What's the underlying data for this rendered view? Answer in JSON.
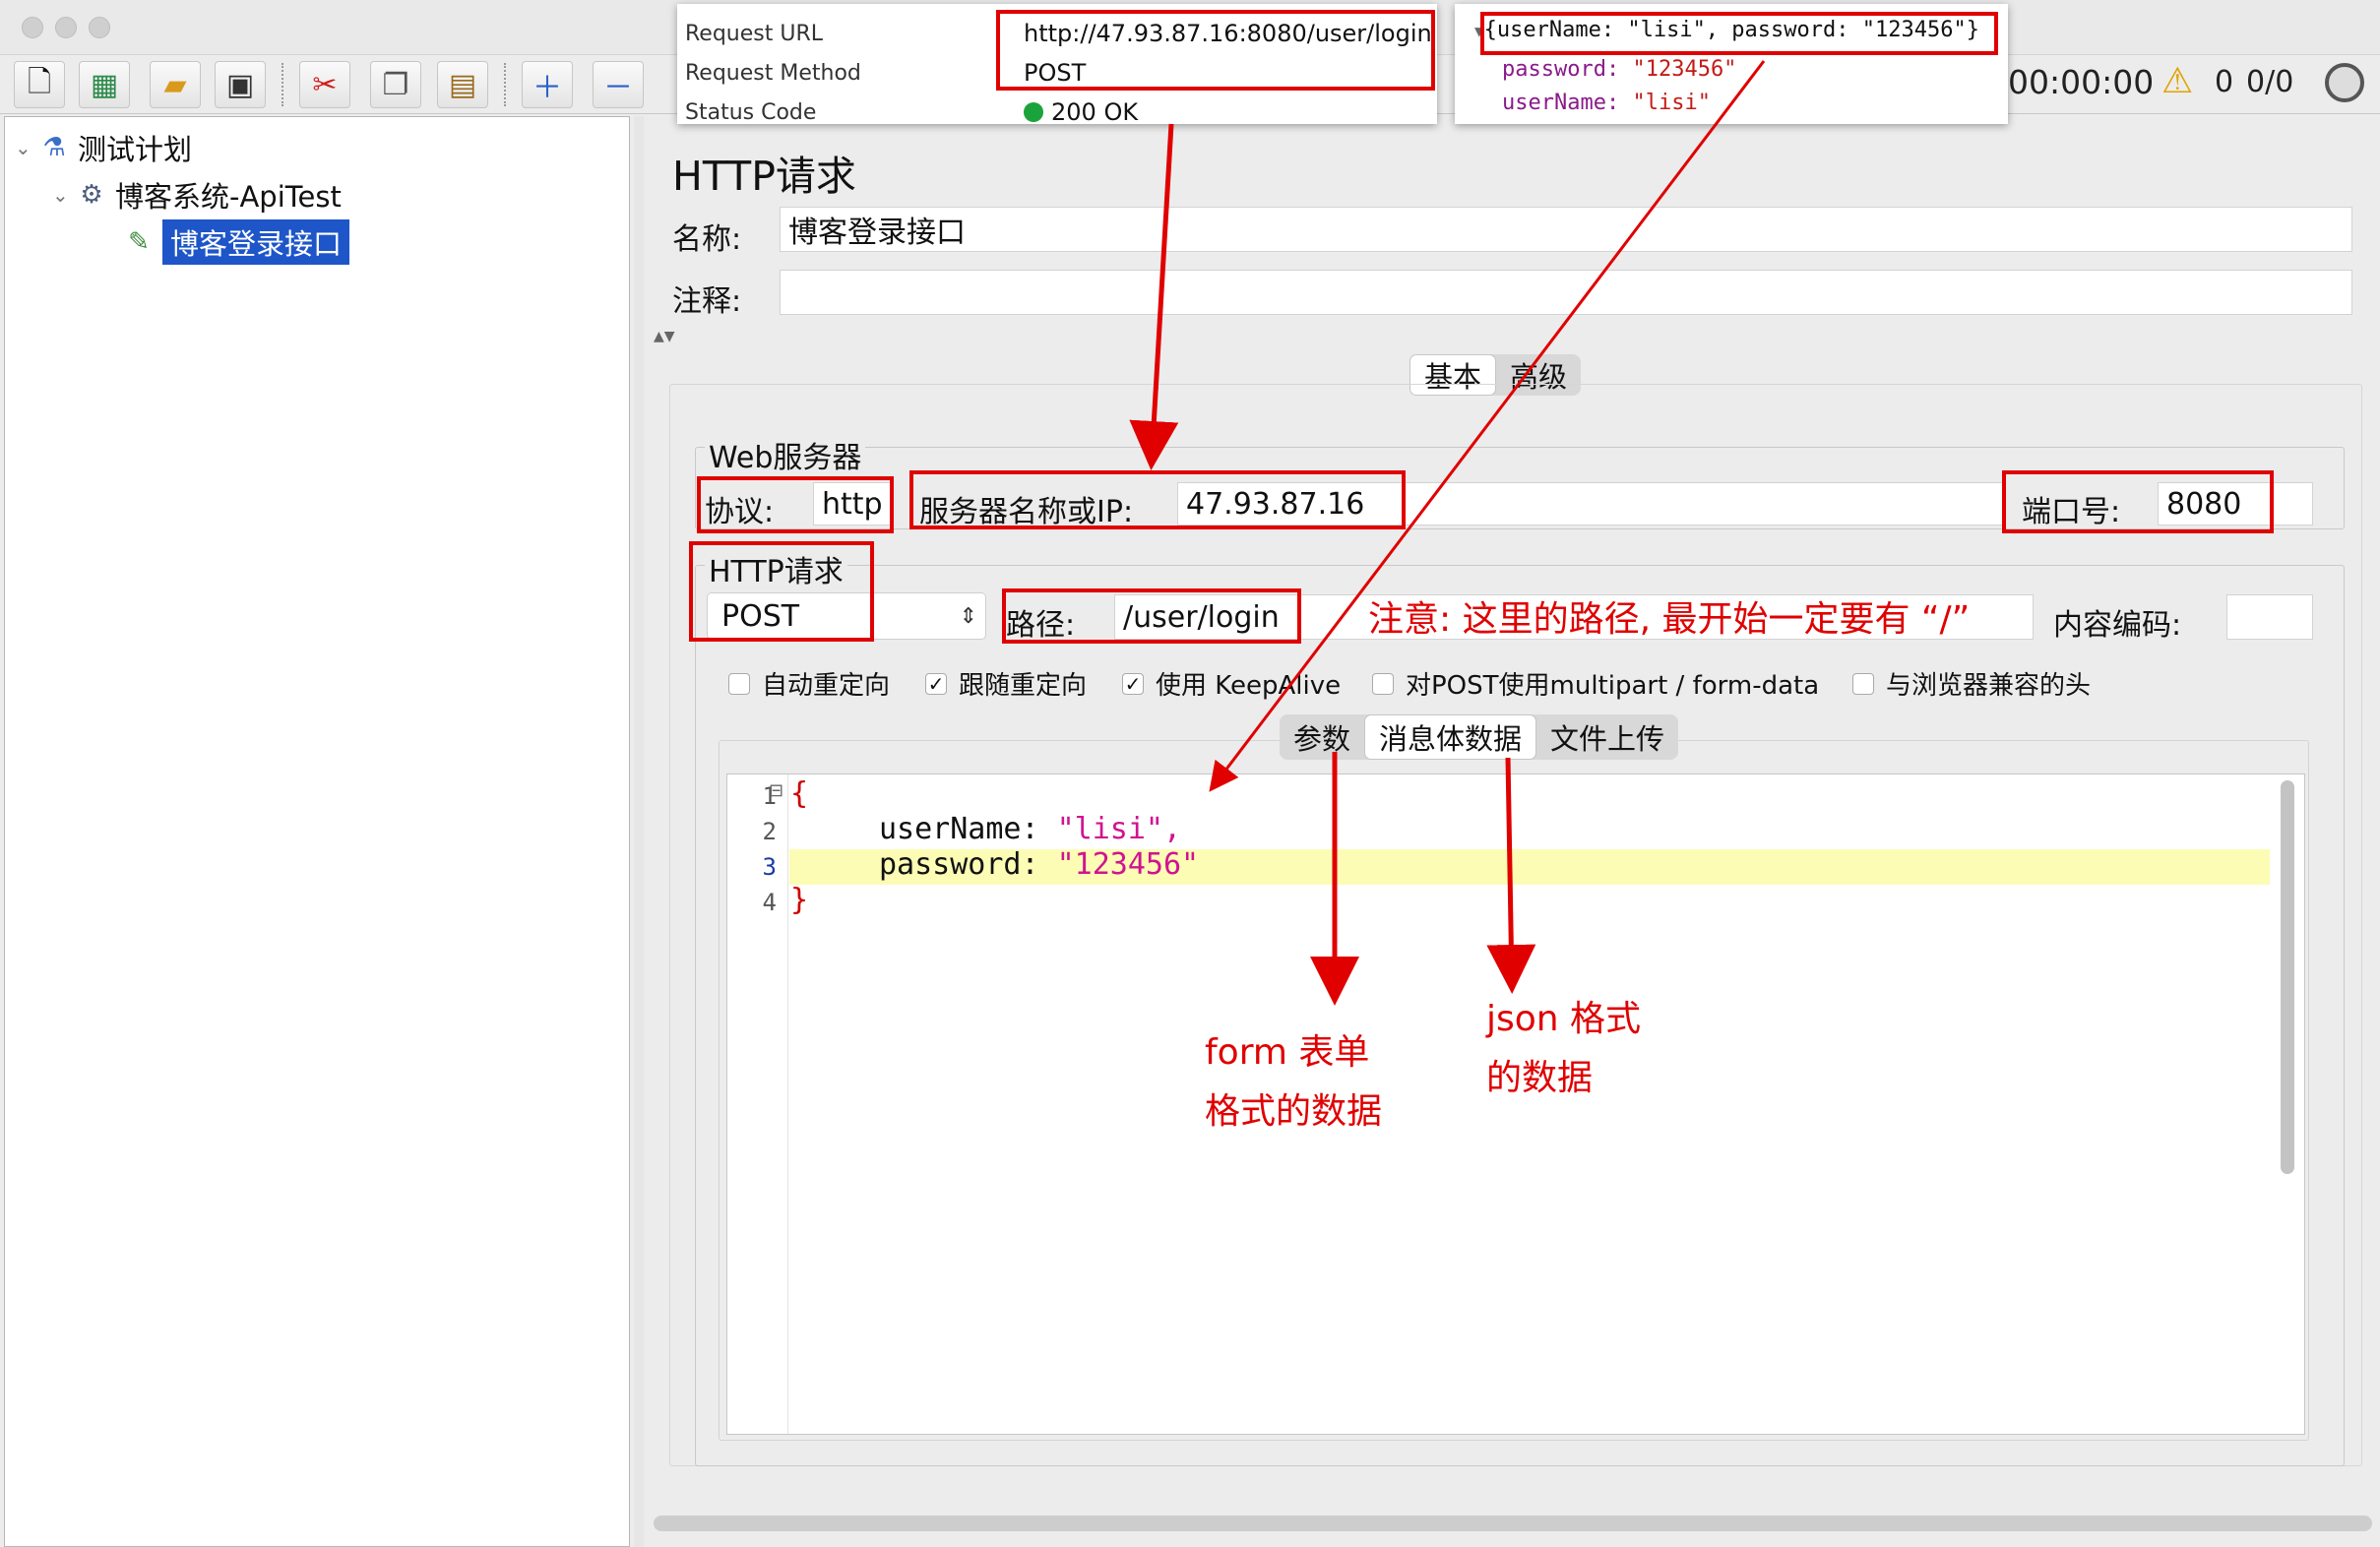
{
  "toolbar": {
    "timer": "00:00:00",
    "warning_count": "0",
    "thread_count": "0/0"
  },
  "tree": {
    "plan": "测试计划",
    "group": "博客系统-ApiTest",
    "sampler": "博客登录接口"
  },
  "sampler": {
    "title": "HTTP请求",
    "name_label": "名称:",
    "name_value": "博客登录接口",
    "comment_label": "注释:",
    "comment_value": "",
    "tabs": [
      "基本",
      "高级"
    ],
    "web_server_title": "Web服务器",
    "protocol_label": "协议:",
    "protocol_value": "http",
    "server_label": "服务器名称或IP:",
    "server_value": "47.93.87.16",
    "port_label": "端口号:",
    "port_value": "8080",
    "http_request_title": "HTTP请求",
    "method_value": "POST",
    "path_label": "路径:",
    "path_value": "/user/login",
    "encoding_label": "内容编码:",
    "encoding_value": "",
    "checkboxes": [
      {
        "label": "自动重定向",
        "checked": false
      },
      {
        "label": "跟随重定向",
        "checked": true
      },
      {
        "label": "使用 KeepAlive",
        "checked": true
      },
      {
        "label": "对POST使用multipart / form-data",
        "checked": false
      },
      {
        "label": "与浏览器兼容的头",
        "checked": false
      }
    ],
    "body_tabs": [
      "参数",
      "消息体数据",
      "文件上传"
    ],
    "body_lines": [
      {
        "num": "1",
        "text": "{"
      },
      {
        "num": "2",
        "key": "userName",
        "val": "\"lisi\","
      },
      {
        "num": "3",
        "key": "password",
        "val": "\"123456\""
      },
      {
        "num": "4",
        "text": "}"
      }
    ]
  },
  "request_popup": {
    "url_label": "Request URL",
    "url_value": "http://47.93.87.16:8080/user/login",
    "method_label": "Request Method",
    "method_value": "POST",
    "status_label": "Status Code",
    "status_value": "200 OK"
  },
  "payload_popup": {
    "summary": "{userName: \"lisi\", password: \"123456\"}",
    "password_key": "password:",
    "password_val": "\"123456\"",
    "username_key": "userName:",
    "username_val": "\"lisi\""
  },
  "annotations": {
    "path_note": "注意: 这里的路径, 最开始一定要有 “/”",
    "form_note_1": "form 表单",
    "form_note_2": "格式的数据",
    "json_note_1": "json 格式",
    "json_note_2": "的数据"
  },
  "colors": {
    "annotation_red": "#e00000",
    "selection_blue": "#1e56c9",
    "highlight_yellow": "#fcfcb5",
    "json_key": "#111111",
    "json_string": "#d0148f",
    "status_green": "#1aa33a"
  }
}
